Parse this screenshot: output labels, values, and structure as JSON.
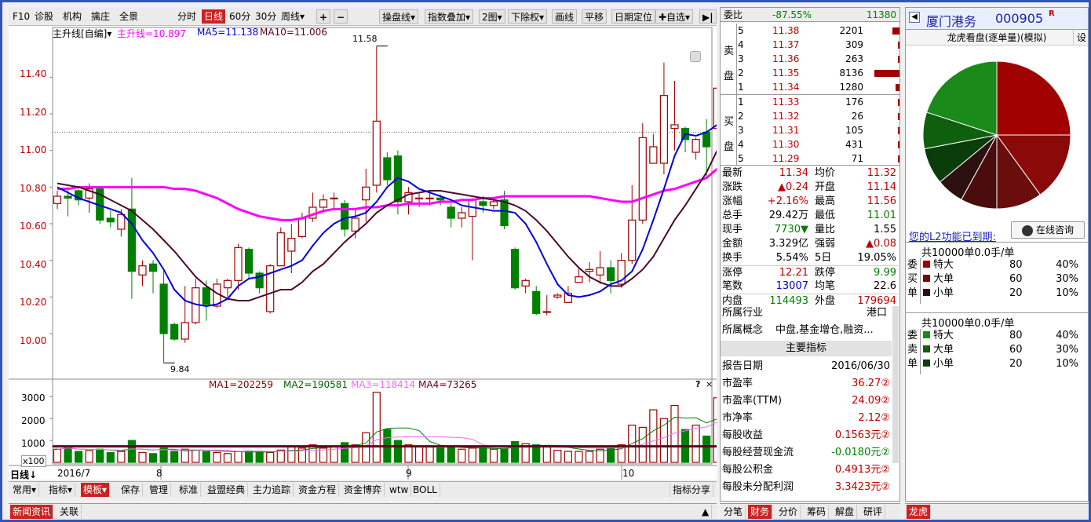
{
  "toolbar": {
    "items": [
      "F10",
      "诊股",
      "机构",
      "擒庄",
      "全景"
    ],
    "periods": [
      "分时",
      "日线",
      "60分",
      "30分",
      "周线▾"
    ],
    "zoom_in": "+",
    "zoom_out": "−",
    "tools": [
      "操盘线▾",
      "指数叠加▾",
      "2图▾",
      "下除权▾",
      "画线",
      "平移",
      "日期定位",
      "✚自选▾"
    ],
    "next": "▶|"
  },
  "main_legend": {
    "indicator": "主升线[自编]▾",
    "line": "主升线=10.897",
    "ma5": "MA5=11.138",
    "ma10": "MA10=11.006"
  },
  "vol_legend": {
    "ma1": "MA1=202259",
    "ma2": "MA2=190581",
    "ma3": "MA3=118414",
    "ma4": "MA4=73265",
    "help": "?",
    "close": "×"
  },
  "price_axis": [
    "11.40",
    "11.20",
    "11.00",
    "10.80",
    "10.60",
    "10.40",
    "10.20",
    "10.00"
  ],
  "vol_axis": [
    "3000",
    "2000",
    "1000",
    "x100"
  ],
  "high_label": "11.58",
  "low_label": "9.84",
  "date_axis": {
    "period": "日线↓",
    "start": "2016/7",
    "m8": "8",
    "m9": "9",
    "m10": "10"
  },
  "chart_data": {
    "type": "candlestick",
    "ylim": [
      9.76,
      11.62
    ],
    "vol_ylim": [
      0,
      3300
    ],
    "candles": [
      [
        10.71,
        10.75,
        10.68,
        10.78,
        600
      ],
      [
        10.75,
        10.74,
        10.64,
        10.8,
        720
      ],
      [
        10.78,
        10.73,
        10.7,
        10.79,
        500
      ],
      [
        10.74,
        10.79,
        10.66,
        10.82,
        540
      ],
      [
        10.79,
        10.62,
        10.6,
        10.8,
        600
      ],
      [
        10.63,
        10.61,
        10.58,
        10.67,
        450
      ],
      [
        10.57,
        10.65,
        10.53,
        10.68,
        500
      ],
      [
        10.68,
        10.34,
        10.19,
        10.85,
        1000
      ],
      [
        10.32,
        10.37,
        10.26,
        10.4,
        450
      ],
      [
        10.38,
        10.34,
        10.22,
        10.4,
        400
      ],
      [
        10.27,
        10.0,
        9.84,
        10.35,
        650
      ],
      [
        10.05,
        9.97,
        9.96,
        10.06,
        500
      ],
      [
        9.97,
        10.06,
        9.95,
        10.26,
        600
      ],
      [
        10.06,
        10.25,
        10.05,
        10.3,
        560
      ],
      [
        10.25,
        10.16,
        10.07,
        10.29,
        500
      ],
      [
        10.15,
        10.27,
        10.14,
        10.3,
        450
      ],
      [
        10.25,
        10.29,
        10.2,
        10.3,
        400
      ],
      [
        10.29,
        10.47,
        10.24,
        10.49,
        500
      ],
      [
        10.46,
        10.33,
        10.3,
        10.47,
        520
      ],
      [
        10.33,
        10.25,
        10.22,
        10.34,
        480
      ],
      [
        10.12,
        10.37,
        10.11,
        10.38,
        450
      ],
      [
        10.37,
        10.55,
        10.37,
        10.58,
        560
      ],
      [
        10.45,
        10.52,
        10.33,
        10.6,
        700
      ],
      [
        10.53,
        10.63,
        10.52,
        10.66,
        650
      ],
      [
        10.63,
        10.69,
        10.61,
        10.77,
        800
      ],
      [
        10.69,
        10.73,
        10.66,
        10.76,
        650
      ],
      [
        10.74,
        10.74,
        10.68,
        10.77,
        700
      ],
      [
        10.71,
        10.57,
        10.53,
        10.73,
        900
      ],
      [
        10.56,
        10.63,
        10.52,
        10.68,
        800
      ],
      [
        10.73,
        10.8,
        10.61,
        10.9,
        1350
      ],
      [
        10.81,
        11.16,
        10.77,
        11.57,
        3200
      ],
      [
        10.96,
        10.84,
        10.81,
        10.99,
        1500
      ],
      [
        10.97,
        10.72,
        10.65,
        11.0,
        1000
      ],
      [
        10.72,
        10.77,
        10.65,
        10.8,
        800
      ],
      [
        10.74,
        10.74,
        10.69,
        10.77,
        750
      ],
      [
        10.74,
        10.74,
        10.7,
        10.77,
        700
      ],
      [
        10.74,
        10.73,
        10.7,
        10.76,
        650
      ],
      [
        10.69,
        10.63,
        10.58,
        10.71,
        700
      ],
      [
        10.63,
        10.66,
        10.58,
        10.69,
        600
      ],
      [
        10.64,
        10.73,
        10.4,
        10.74,
        650
      ],
      [
        10.72,
        10.7,
        10.66,
        10.75,
        650
      ],
      [
        10.7,
        10.72,
        10.68,
        10.74,
        600
      ],
      [
        10.73,
        10.59,
        10.57,
        10.78,
        600
      ],
      [
        10.46,
        10.25,
        10.24,
        10.47,
        950
      ],
      [
        10.26,
        10.29,
        10.22,
        10.3,
        850
      ],
      [
        10.23,
        10.11,
        10.1,
        10.26,
        800
      ],
      [
        10.12,
        10.12,
        10.1,
        10.21,
        700
      ],
      [
        10.2,
        10.21,
        10.19,
        10.22,
        550
      ],
      [
        10.17,
        10.22,
        10.17,
        10.26,
        500
      ],
      [
        10.28,
        10.31,
        10.29,
        10.36,
        500
      ],
      [
        10.34,
        10.35,
        10.28,
        10.39,
        500
      ],
      [
        10.32,
        10.36,
        10.27,
        10.45,
        600
      ],
      [
        10.36,
        10.29,
        10.22,
        10.4,
        700
      ],
      [
        10.27,
        10.4,
        10.25,
        10.44,
        800
      ],
      [
        10.4,
        10.62,
        10.38,
        10.81,
        1700
      ],
      [
        10.62,
        11.07,
        10.6,
        11.15,
        1600
      ],
      [
        10.93,
        11.02,
        10.95,
        11.09,
        2400
      ],
      [
        10.93,
        11.3,
        10.87,
        11.48,
        2000
      ],
      [
        11.12,
        11.14,
        11.0,
        11.38,
        2600
      ],
      [
        11.12,
        11.06,
        10.99,
        11.13,
        1500
      ],
      [
        10.99,
        11.06,
        10.95,
        11.07,
        1700
      ],
      [
        11.1,
        11.02,
        10.85,
        11.17,
        1200
      ],
      [
        11.12,
        11.34,
        10.89,
        11.56,
        2950
      ]
    ],
    "ma5": [
      10.8,
      10.77,
      10.74,
      10.72,
      10.7,
      10.68,
      10.66,
      10.6,
      10.51,
      10.44,
      10.35,
      10.24,
      10.18,
      10.16,
      10.15,
      10.16,
      10.19,
      10.26,
      10.3,
      10.31,
      10.33,
      10.35,
      10.37,
      10.4,
      10.48,
      10.55,
      10.6,
      10.63,
      10.64,
      10.66,
      10.72,
      10.8,
      10.85,
      10.83,
      10.79,
      10.77,
      10.75,
      10.73,
      10.7,
      10.69,
      10.68,
      10.67,
      10.67,
      10.66,
      10.6,
      10.5,
      10.38,
      10.27,
      10.21,
      10.2,
      10.21,
      10.23,
      10.27,
      10.29,
      10.34,
      10.46,
      10.62,
      10.79,
      10.97,
      11.09,
      11.08,
      11.1,
      11.14
    ],
    "ma10": [
      10.82,
      10.81,
      10.8,
      10.78,
      10.76,
      10.73,
      10.7,
      10.67,
      10.62,
      10.57,
      10.51,
      10.45,
      10.38,
      10.31,
      10.26,
      10.22,
      10.19,
      10.18,
      10.18,
      10.2,
      10.22,
      10.24,
      10.24,
      10.28,
      10.34,
      10.38,
      10.44,
      10.5,
      10.55,
      10.6,
      10.66,
      10.7,
      10.73,
      10.76,
      10.77,
      10.78,
      10.78,
      10.77,
      10.76,
      10.75,
      10.74,
      10.73,
      10.72,
      10.7,
      10.67,
      10.62,
      10.56,
      10.49,
      10.42,
      10.36,
      10.31,
      10.28,
      10.26,
      10.26,
      10.3,
      10.35,
      10.42,
      10.52,
      10.62,
      10.7,
      10.79,
      10.88,
      11.0
    ],
    "mainline": [
      10.79,
      10.79,
      10.8,
      10.8,
      10.8,
      10.8,
      10.8,
      10.8,
      10.8,
      10.8,
      10.8,
      10.79,
      10.79,
      10.78,
      10.76,
      10.74,
      10.71,
      10.68,
      10.66,
      10.64,
      10.63,
      10.62,
      10.62,
      10.63,
      10.65,
      10.67,
      10.68,
      10.68,
      10.68,
      10.69,
      10.69,
      10.7,
      10.7,
      10.71,
      10.71,
      10.71,
      10.72,
      10.72,
      10.73,
      10.73,
      10.74,
      10.74,
      10.75,
      10.75,
      10.75,
      10.75,
      10.75,
      10.75,
      10.75,
      10.75,
      10.75,
      10.74,
      10.73,
      10.72,
      10.72,
      10.74,
      10.76,
      10.78,
      10.79,
      10.81,
      10.83,
      10.85,
      10.9
    ]
  },
  "quote": {
    "weibi_label": "委比",
    "weibi_pct": "-87.55%",
    "weibi_val": "11380",
    "sell_label": "卖盘",
    "buy_label": "买盘",
    "asks": [
      [
        "5",
        "11.38",
        "2201"
      ],
      [
        "4",
        "11.37",
        "309"
      ],
      [
        "3",
        "11.36",
        "263"
      ],
      [
        "2",
        "11.35",
        "8136"
      ],
      [
        "1",
        "11.34",
        "1280"
      ]
    ],
    "bids": [
      [
        "1",
        "11.33",
        "176"
      ],
      [
        "2",
        "11.32",
        "26"
      ],
      [
        "3",
        "11.31",
        "105"
      ],
      [
        "4",
        "11.30",
        "431"
      ],
      [
        "5",
        "11.29",
        "71"
      ]
    ],
    "stats": [
      [
        "最新",
        "11.34",
        "均价",
        "11.32"
      ],
      [
        "涨跌",
        "▲0.24",
        "开盘",
        "11.14"
      ],
      [
        "涨幅",
        "+2.16%",
        "最高",
        "11.56"
      ],
      [
        "总手",
        "29.42万",
        "最低",
        "11.01"
      ],
      [
        "现手",
        "7730▼",
        "量比",
        "1.55"
      ],
      [
        "金额",
        "3.329亿",
        "强弱",
        "▲0.08"
      ],
      [
        "换手",
        "5.54%",
        "5日",
        "19.05%"
      ],
      [
        "涨停",
        "12.21",
        "跌停",
        "9.99"
      ],
      [
        "笔数",
        "13007",
        "均笔",
        "22.6"
      ],
      [
        "内盘",
        "114493",
        "外盘",
        "179694"
      ]
    ],
    "industry_label": "所属行业",
    "industry": "港口",
    "concept_label": "所属概念",
    "concept": "中盘,基金增仓,融资...",
    "main_title": "主要指标",
    "indicators": [
      [
        "报告日期",
        "2016/06/30"
      ],
      [
        "市盈率",
        "36.27②"
      ],
      [
        "市盈率(TTM)",
        "24.09②"
      ],
      [
        "市净率",
        "2.12②"
      ],
      [
        "每股收益",
        "0.1563元②"
      ],
      [
        "每股经营现金流",
        "-0.0180元②"
      ],
      [
        "每股公积金",
        "0.4913元②"
      ],
      [
        "每股未分配利润",
        "3.3423元②"
      ]
    ]
  },
  "right": {
    "stock_name": "厦门港务",
    "stock_code": "000905",
    "badge": "R",
    "panel_title": "龙虎看盘(逐单量)(模拟)",
    "settings": "设",
    "l2_text": "您的L2功能已到期:",
    "consult_btn": "在线咨询",
    "buy_block": {
      "summary": "共10000单0.0手/单",
      "side": "委买单",
      "rows": [
        [
          "特大",
          "80",
          "40%"
        ],
        [
          "大单",
          "60",
          "30%"
        ],
        [
          "小单",
          "20",
          "10%"
        ]
      ]
    },
    "sell_block": {
      "summary": "共10000单0.0手/单",
      "side": "委卖单",
      "rows": [
        [
          "特大",
          "80",
          "40%"
        ],
        [
          "大单",
          "60",
          "30%"
        ],
        [
          "小单",
          "20",
          "10%"
        ]
      ]
    },
    "pie_colors": [
      "#a00000",
      "#8a0a0a",
      "#6a0d0d",
      "#4a0c0c",
      "#2d1010",
      "#0a3d0a",
      "#0f5f0f",
      "#1a8a1a"
    ],
    "pie_values": [
      25,
      15,
      10,
      8,
      6,
      8,
      8,
      20
    ]
  },
  "bottom_tabs": [
    "常用▾",
    "指标▾",
    "模板▾",
    "保存",
    "管理",
    "标准",
    "益盟经典",
    "主力追踪",
    "资金方程",
    "资金博弈",
    "wtw",
    "BOLL",
    "指标分享"
  ],
  "news_tabs": [
    "新闻资讯",
    "关联"
  ],
  "quote_tabs": [
    "分笔",
    "财务",
    "分价",
    "筹码",
    "解盘",
    "研评"
  ],
  "right_tabs": [
    "龙虎"
  ]
}
